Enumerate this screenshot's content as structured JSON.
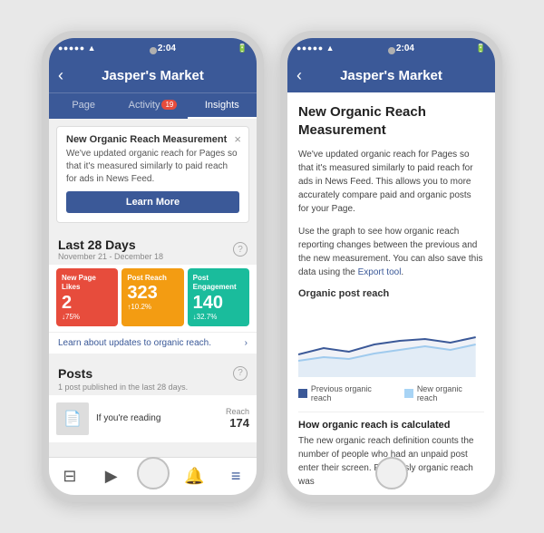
{
  "scene": {
    "bg_color": "#e8e8e8"
  },
  "phone1": {
    "status": {
      "left": "●●●●● ▲",
      "time": "2:04",
      "right": "🔋"
    },
    "nav": {
      "title": "Jasper's Market",
      "back": "‹"
    },
    "tabs": [
      {
        "label": "Page",
        "active": false
      },
      {
        "label": "Activity",
        "badge": "19",
        "active": false
      },
      {
        "label": "Insights",
        "active": true
      }
    ],
    "notification": {
      "title": "New Organic Reach Measurement",
      "text": "We've updated organic reach for Pages so that it's measured similarly to paid reach for ads in News Feed.",
      "close": "×",
      "button": "Learn More"
    },
    "stats": {
      "header": "Last 28 Days",
      "date_range": "November 21 - December 18",
      "cards": [
        {
          "label": "New Page Likes",
          "value": "2",
          "change": "↓75%",
          "color": "red"
        },
        {
          "label": "Post Reach",
          "value": "323",
          "change": "↑10.2%",
          "color": "orange"
        },
        {
          "label": "Post Engagement",
          "value": "140",
          "change": "↓32.7%",
          "color": "teal"
        }
      ],
      "organic_link": "Learn about updates to organic reach."
    },
    "posts": {
      "title": "Posts",
      "subtitle": "1 post published in the last 28 days.",
      "items": [
        {
          "thumb": "📄",
          "text": "If you're reading",
          "reach_label": "Reach",
          "reach_value": "174"
        }
      ]
    },
    "bottom_bar": {
      "icons": [
        "⊟",
        "▶",
        "⊞",
        "🔔",
        "≡"
      ]
    }
  },
  "phone2": {
    "status": {
      "left": "●●●●● ▲",
      "time": "2:04",
      "right": "🔋"
    },
    "nav": {
      "title": "Jasper's Market",
      "back": "‹"
    },
    "article": {
      "title": "New Organic Reach Measurement",
      "body1": "We've updated organic reach for Pages so that it's measured similarly to paid reach for ads in News Feed. This allows you to more accurately compare paid and organic posts for your Page.",
      "body2": "Use the graph to see how organic reach reporting changes between the previous and the new measurement. You can also save this data using the ",
      "link_text": "Export tool",
      "body2_end": ".",
      "chart_label": "Organic post reach",
      "legend": [
        {
          "label": "Previous organic reach",
          "color": "#3b5998"
        },
        {
          "label": "New organic reach",
          "color": "#a8d4f5"
        }
      ],
      "footer_title": "How organic reach is calculated",
      "footer_text": "The new organic reach definition counts the number of people who had an unpaid post enter their screen. Previously organic reach was"
    }
  }
}
